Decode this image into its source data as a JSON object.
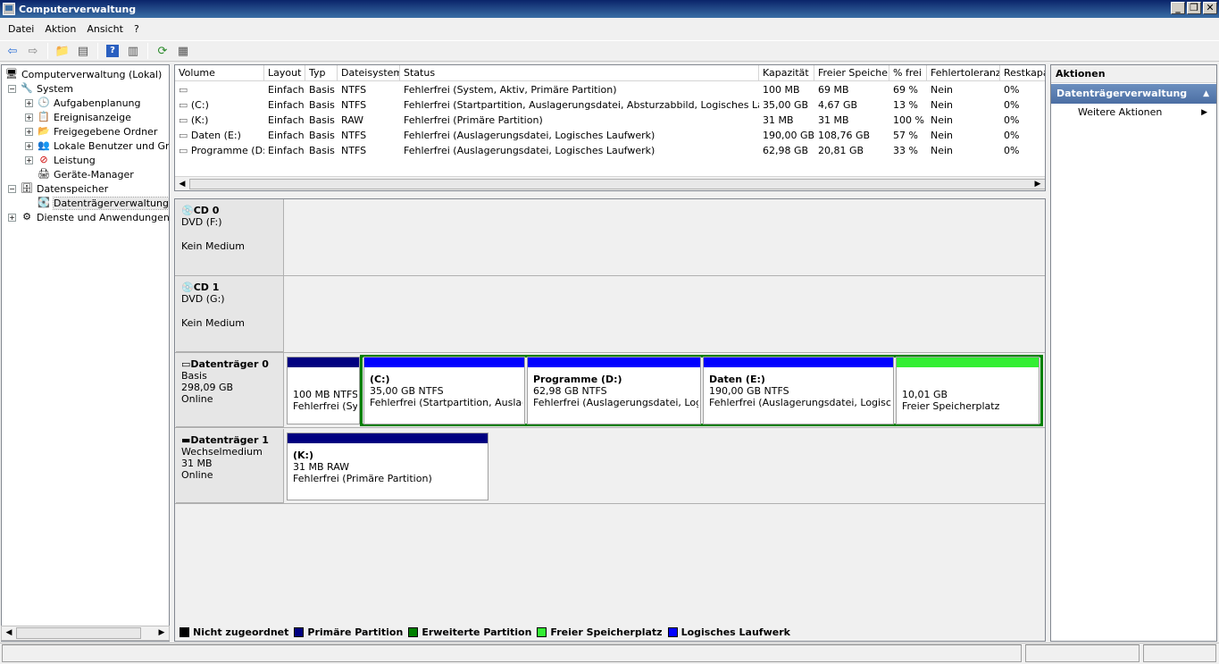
{
  "window": {
    "title": "Computerverwaltung"
  },
  "menu": [
    "Datei",
    "Aktion",
    "Ansicht",
    "?"
  ],
  "tree": {
    "root": "Computerverwaltung (Lokal)",
    "system": "System",
    "aufgaben": "Aufgabenplanung",
    "ereignis": "Ereignisanzeige",
    "ordner": "Freigegebene Ordner",
    "benutzer": "Lokale Benutzer und Gruppen",
    "leistung": "Leistung",
    "geraete": "Geräte-Manager",
    "speicher": "Datenspeicher",
    "dtv": "Datenträgerverwaltung",
    "dienste": "Dienste und Anwendungen"
  },
  "columns": [
    "Volume",
    "Layout",
    "Typ",
    "Dateisystem",
    "Status",
    "Kapazität",
    "Freier Speicher",
    "% frei",
    "Fehlertoleranz",
    "Restkapa"
  ],
  "volumes": [
    {
      "volume": "",
      "layout": "Einfach",
      "typ": "Basis",
      "fs": "NTFS",
      "status": "Fehlerfrei (System, Aktiv, Primäre Partition)",
      "kap": "100 MB",
      "frei": "69 MB",
      "pct": "69 %",
      "ft": "Nein",
      "rest": "0%"
    },
    {
      "volume": "(C:)",
      "layout": "Einfach",
      "typ": "Basis",
      "fs": "NTFS",
      "status": "Fehlerfrei (Startpartition, Auslagerungsdatei, Absturzabbild, Logisches Laufwerk)",
      "kap": "35,00 GB",
      "frei": "4,67 GB",
      "pct": "13 %",
      "ft": "Nein",
      "rest": "0%"
    },
    {
      "volume": "(K:)",
      "layout": "Einfach",
      "typ": "Basis",
      "fs": "RAW",
      "status": "Fehlerfrei (Primäre Partition)",
      "kap": "31 MB",
      "frei": "31 MB",
      "pct": "100 %",
      "ft": "Nein",
      "rest": "0%"
    },
    {
      "volume": "Daten (E:)",
      "layout": "Einfach",
      "typ": "Basis",
      "fs": "NTFS",
      "status": "Fehlerfrei (Auslagerungsdatei, Logisches Laufwerk)",
      "kap": "190,00 GB",
      "frei": "108,76 GB",
      "pct": "57 %",
      "ft": "Nein",
      "rest": "0%"
    },
    {
      "volume": "Programme (D:)",
      "layout": "Einfach",
      "typ": "Basis",
      "fs": "NTFS",
      "status": "Fehlerfrei (Auslagerungsdatei, Logisches Laufwerk)",
      "kap": "62,98 GB",
      "frei": "20,81 GB",
      "pct": "33 %",
      "ft": "Nein",
      "rest": "0%"
    }
  ],
  "disks": {
    "cd0": {
      "name": "CD 0",
      "type": "DVD (F:)",
      "media": "Kein Medium"
    },
    "cd1": {
      "name": "CD 1",
      "type": "DVD (G:)",
      "media": "Kein Medium"
    },
    "d0": {
      "name": "Datenträger 0",
      "type": "Basis",
      "size": "298,09 GB",
      "state": "Online"
    },
    "d1": {
      "name": "Datenträger 1",
      "type": "Wechselmedium",
      "size": "31 MB",
      "state": "Online"
    }
  },
  "partitions": {
    "p0": {
      "size": "100 MB NTFS",
      "status": "Fehlerfrei (Sys"
    },
    "p1": {
      "name": "(C:)",
      "size": "35,00 GB NTFS",
      "status": "Fehlerfrei (Startpartition, Auslagen"
    },
    "p2": {
      "name": "Programme  (D:)",
      "size": "62,98 GB NTFS",
      "status": "Fehlerfrei (Auslagerungsdatei, Logisch"
    },
    "p3": {
      "name": "Daten  (E:)",
      "size": "190,00 GB NTFS",
      "status": "Fehlerfrei (Auslagerungsdatei, Logisches L"
    },
    "p4": {
      "size": "10,01 GB",
      "status": "Freier Speicherplatz"
    },
    "k": {
      "name": "(K:)",
      "size": "31 MB RAW",
      "status": "Fehlerfrei (Primäre Partition)"
    }
  },
  "legend": [
    "Nicht zugeordnet",
    "Primäre Partition",
    "Erweiterte Partition",
    "Freier Speicherplatz",
    "Logisches Laufwerk"
  ],
  "colors": {
    "unallocated": "#000000",
    "primary": "#000080",
    "extended": "#008000",
    "free": "#33ee33",
    "logical": "#0000ff"
  },
  "actions": {
    "header": "Aktionen",
    "section": "Datenträgerverwaltung",
    "item": "Weitere Aktionen"
  }
}
